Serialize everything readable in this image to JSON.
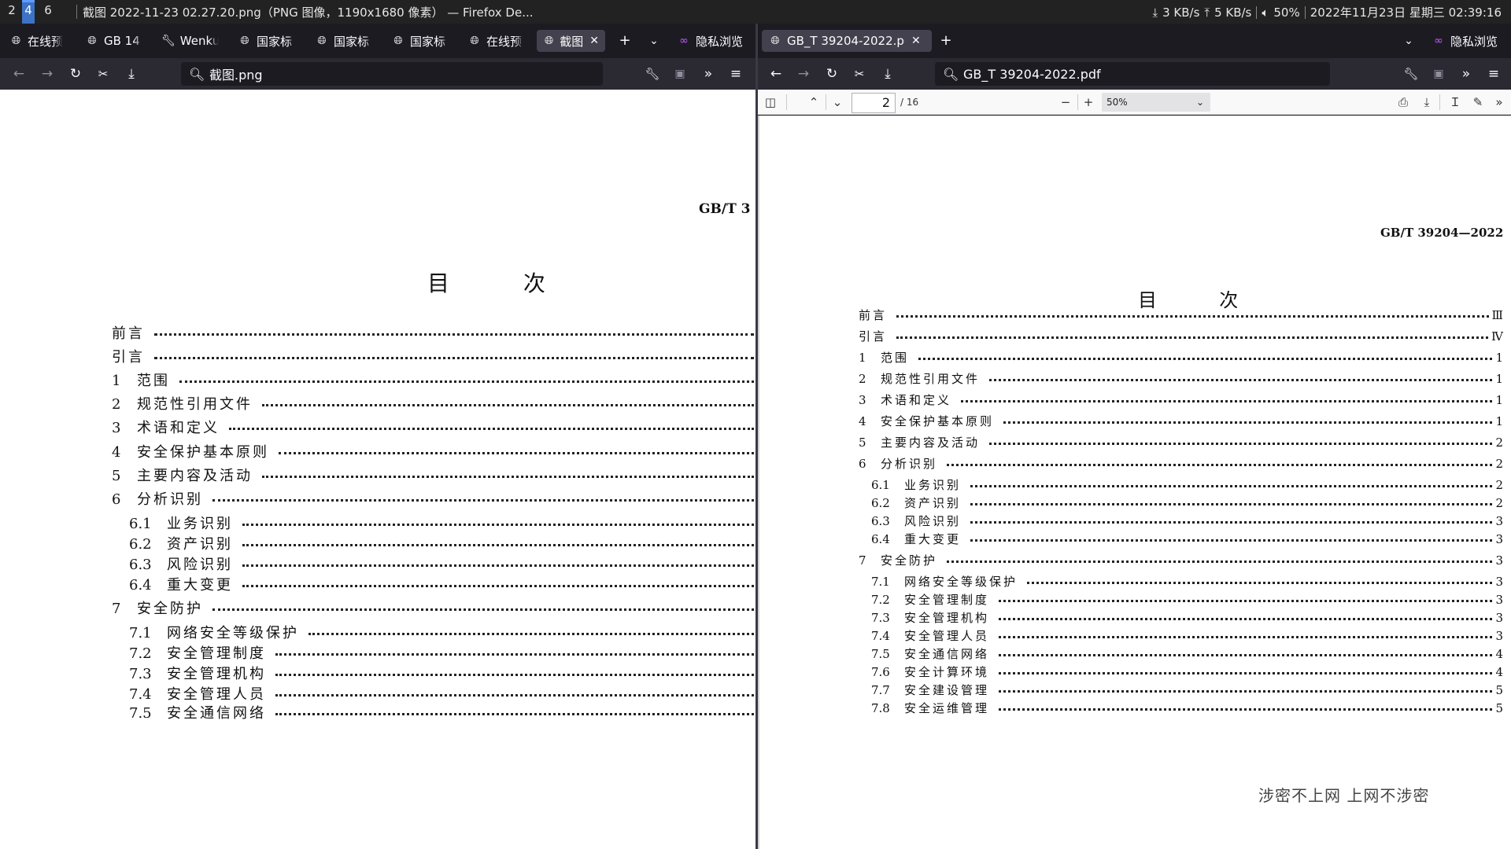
{
  "system_bar": {
    "workspaces": [
      "2",
      "4",
      "6"
    ],
    "active_workspace": "4",
    "window_title": "截图 2022-11-23 02.27.20.png（PNG 图像，1190x1680 像素） — Firefox De...",
    "download_speed": "3 KB/s",
    "upload_speed": "5 KB/s",
    "volume": "50%",
    "datetime": "2022年11月23日 星期三 02:39:16"
  },
  "left_window": {
    "tabs": [
      {
        "label": "在线预",
        "icon": "globe-icon"
      },
      {
        "label": "GB 14",
        "icon": "globe-icon"
      },
      {
        "label": "Wenku",
        "icon": "wrench-icon"
      },
      {
        "label": "国家标",
        "icon": "globe-icon"
      },
      {
        "label": "国家标",
        "icon": "globe-icon"
      },
      {
        "label": "国家标",
        "icon": "globe-icon"
      },
      {
        "label": "在线预",
        "icon": "globe-icon"
      },
      {
        "label": "截图",
        "icon": "globe-icon",
        "selected": true
      }
    ],
    "private_label": "隐私浏览",
    "url": "截图.png",
    "document": {
      "header": "GB/T 3",
      "toc_title_left": "目",
      "toc_title_right": "次",
      "entries": [
        {
          "num": "",
          "label": "前言",
          "level": 0
        },
        {
          "num": "",
          "label": "引言",
          "level": 0
        },
        {
          "num": "1",
          "label": "范围",
          "level": 0
        },
        {
          "num": "2",
          "label": "规范性引用文件",
          "level": 0
        },
        {
          "num": "3",
          "label": "术语和定义",
          "level": 0
        },
        {
          "num": "4",
          "label": "安全保护基本原则",
          "level": 0
        },
        {
          "num": "5",
          "label": "主要内容及活动",
          "level": 0
        },
        {
          "num": "6",
          "label": "分析识别",
          "level": 0
        },
        {
          "num": "6.1",
          "label": "业务识别",
          "level": 1
        },
        {
          "num": "6.2",
          "label": "资产识别",
          "level": 1
        },
        {
          "num": "6.3",
          "label": "风险识别",
          "level": 1
        },
        {
          "num": "6.4",
          "label": "重大变更",
          "level": 1
        },
        {
          "num": "7",
          "label": "安全防护",
          "level": 0
        },
        {
          "num": "7.1",
          "label": "网络安全等级保护",
          "level": 1
        },
        {
          "num": "7.2",
          "label": "安全管理制度",
          "level": 1
        },
        {
          "num": "7.3",
          "label": "安全管理机构",
          "level": 1
        },
        {
          "num": "7.4",
          "label": "安全管理人员",
          "level": 1
        },
        {
          "num": "7.5",
          "label": "安全通信网络",
          "level": 1
        }
      ]
    }
  },
  "right_window": {
    "tab": {
      "label": "GB_T 39204-2022.pdf",
      "icon": "globe-icon"
    },
    "private_label": "隐私浏览",
    "url": "GB_T 39204-2022.pdf",
    "pdf_toolbar": {
      "page_number": "2",
      "page_total": "/ 16",
      "zoom": "50%"
    },
    "document": {
      "header": "GB/T  39204—2022",
      "toc_title_left": "目",
      "toc_title_right": "次",
      "watermark": "涉密不上网  上网不涉密",
      "entries": [
        {
          "num": "",
          "label": "前言",
          "page": "Ⅲ",
          "level": 0
        },
        {
          "num": "",
          "label": "引言",
          "page": "Ⅳ",
          "level": 0
        },
        {
          "num": "1",
          "label": "范围",
          "page": "1",
          "level": 0
        },
        {
          "num": "2",
          "label": "规范性引用文件",
          "page": "1",
          "level": 0
        },
        {
          "num": "3",
          "label": "术语和定义",
          "page": "1",
          "level": 0
        },
        {
          "num": "4",
          "label": "安全保护基本原则",
          "page": "1",
          "level": 0
        },
        {
          "num": "5",
          "label": "主要内容及活动",
          "page": "2",
          "level": 0
        },
        {
          "num": "6",
          "label": "分析识别",
          "page": "2",
          "level": 0
        },
        {
          "num": "6.1",
          "label": "业务识别",
          "page": "2",
          "level": 1
        },
        {
          "num": "6.2",
          "label": "资产识别",
          "page": "2",
          "level": 1
        },
        {
          "num": "6.3",
          "label": "风险识别",
          "page": "3",
          "level": 1
        },
        {
          "num": "6.4",
          "label": "重大变更",
          "page": "3",
          "level": 1
        },
        {
          "num": "7",
          "label": "安全防护",
          "page": "3",
          "level": 0
        },
        {
          "num": "7.1",
          "label": "网络安全等级保护",
          "page": "3",
          "level": 1
        },
        {
          "num": "7.2",
          "label": "安全管理制度",
          "page": "3",
          "level": 1
        },
        {
          "num": "7.3",
          "label": "安全管理机构",
          "page": "3",
          "level": 1
        },
        {
          "num": "7.4",
          "label": "安全管理人员",
          "page": "3",
          "level": 1
        },
        {
          "num": "7.5",
          "label": "安全通信网络",
          "page": "4",
          "level": 1
        },
        {
          "num": "7.6",
          "label": "安全计算环境",
          "page": "4",
          "level": 1
        },
        {
          "num": "7.7",
          "label": "安全建设管理",
          "page": "5",
          "level": 1
        },
        {
          "num": "7.8",
          "label": "安全运维管理",
          "page": "5",
          "level": 1
        }
      ]
    }
  },
  "colors": {
    "chrome_dark": "#1c1b22",
    "toolbar": "#2b2a33",
    "accent_tab": "#00ddff",
    "active_workspace": "#3d73c6",
    "private_icon": "#c45aff"
  }
}
